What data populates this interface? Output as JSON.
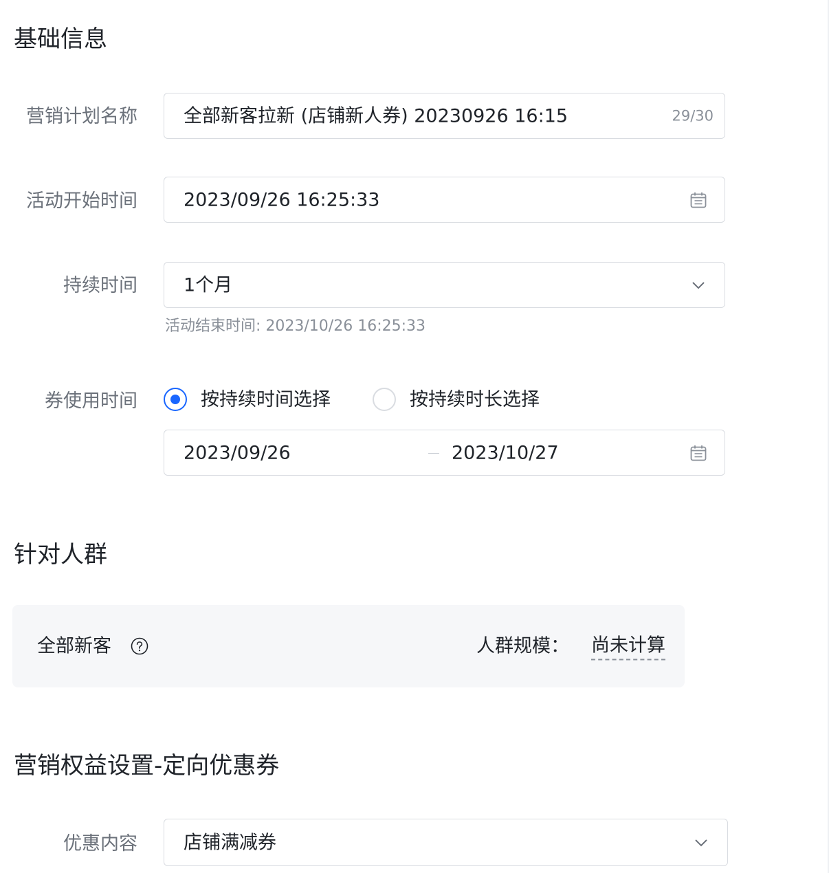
{
  "basic_info": {
    "title": "基础信息",
    "plan_name": {
      "label": "营销计划名称",
      "value": "全部新客拉新 (店铺新人券) 20230926 16:15",
      "counter": "29/30"
    },
    "start_time": {
      "label": "活动开始时间",
      "value": "2023/09/26 16:25:33",
      "icon": "calendar-icon"
    },
    "duration": {
      "label": "持续时间",
      "value": "1个月",
      "icon": "chevron-down-icon",
      "hint": "活动结束时间: 2023/10/26 16:25:33"
    },
    "coupon_time": {
      "label": "券使用时间",
      "options": [
        {
          "label": "按持续时间选择",
          "checked": true
        },
        {
          "label": "按持续时长选择",
          "checked": false
        }
      ],
      "range_start": "2023/09/26",
      "range_end": "2023/10/27",
      "icon": "calendar-icon"
    }
  },
  "target_crowd": {
    "title": "针对人群",
    "crowd_name": "全部新客",
    "help_icon": "question-circle-icon",
    "scale_label": "人群规模：",
    "scale_value": "尚未计算"
  },
  "benefit": {
    "title": "营销权益设置-定向优惠券",
    "content": {
      "label": "优惠内容",
      "value": "店铺满减券",
      "icon": "chevron-down-icon"
    }
  },
  "colors": {
    "primary": "#1966ff",
    "border": "#d9dce1",
    "label": "#6b717a",
    "hint": "#8a9099",
    "card_bg": "#f6f7f9"
  }
}
